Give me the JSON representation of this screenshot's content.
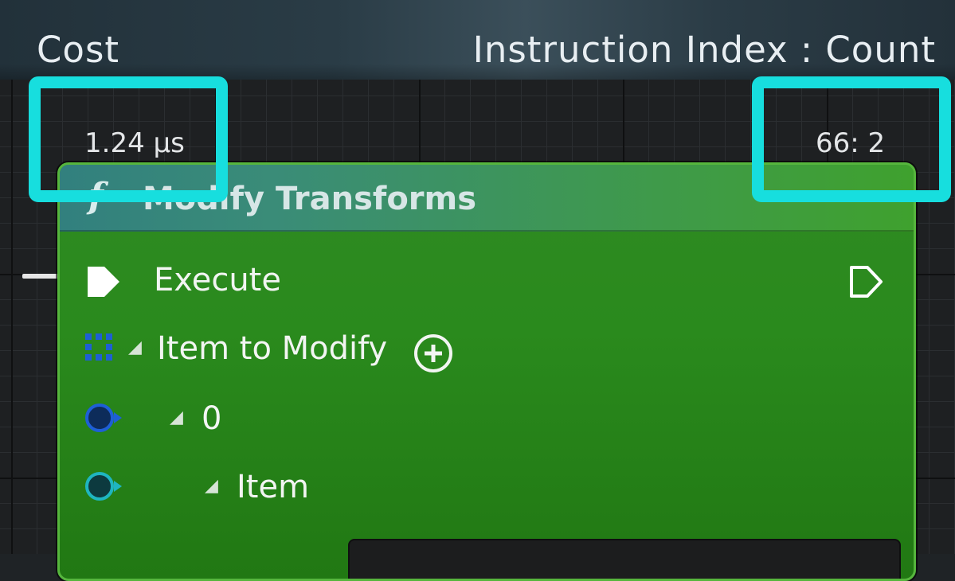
{
  "header": {
    "left_label": "Cost",
    "right_label": "Instruction Index : Count"
  },
  "stats": {
    "cost": "1.24 µs",
    "instruction_count": "66: 2"
  },
  "node": {
    "icon": "f",
    "title": "Modify Transforms",
    "pins": {
      "execute": "Execute",
      "item_to_modify": "Item to Modify",
      "index_0": "0",
      "item": "Item"
    }
  },
  "colors": {
    "highlight": "#17dede",
    "node_body": "#2a8a1d",
    "node_header": "#32807e",
    "canvas": "#1e2022"
  },
  "icons": [
    "exec-input-pin-icon",
    "exec-output-pin-icon",
    "array-pin-icon",
    "add-pin-icon",
    "struct-pin-icon",
    "transform-pin-icon"
  ]
}
